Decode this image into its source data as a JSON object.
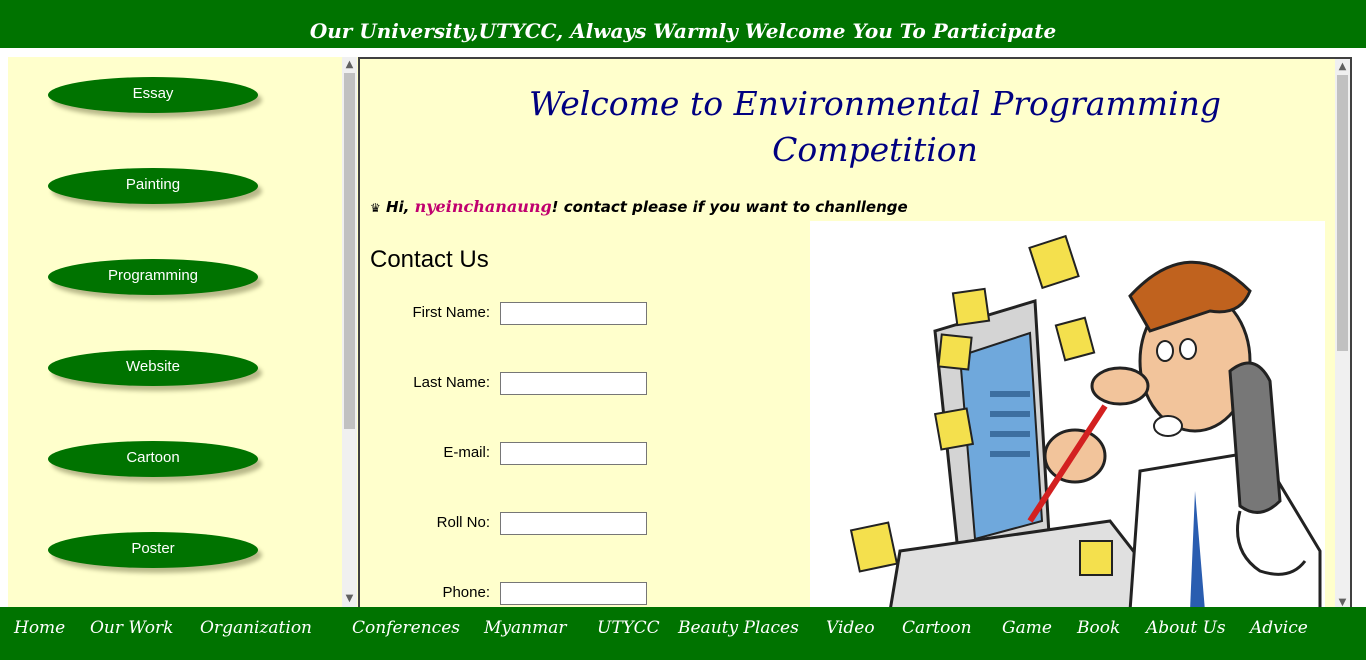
{
  "banner": {
    "text": "Our University,UTYCC, Always Warmly Welcome You To Participate"
  },
  "sidebar": {
    "items": [
      {
        "label": "Essay"
      },
      {
        "label": "Painting"
      },
      {
        "label": "Programming"
      },
      {
        "label": "Website"
      },
      {
        "label": "Cartoon"
      },
      {
        "label": "Poster"
      }
    ]
  },
  "main": {
    "title_line1": "Welcome to Environmental Programming",
    "title_line2": "Competition",
    "greeting": {
      "icon": "crown-icon",
      "prefix": "Hi, ",
      "username": "nyeinchanaung",
      "suffix": "! contact please if you want to chanllenge"
    },
    "contact_heading": "Contact Us",
    "form": {
      "first_name_label": "First Name:",
      "first_name_value": "",
      "last_name_label": "Last Name:",
      "last_name_value": "",
      "email_label": "E-mail:",
      "email_value": "",
      "roll_no_label": "Roll No:",
      "roll_no_value": "",
      "phone_label": "Phone:",
      "phone_value": ""
    }
  },
  "nav": {
    "items": [
      {
        "label": "Home"
      },
      {
        "label": "Our Work"
      },
      {
        "label": "Organization"
      },
      {
        "label": "Conferences"
      },
      {
        "label": "Myanmar"
      },
      {
        "label": "UTYCC"
      },
      {
        "label": "Beauty Places"
      },
      {
        "label": "Video"
      },
      {
        "label": "Cartoon"
      },
      {
        "label": "Game"
      },
      {
        "label": "Book"
      },
      {
        "label": "About Us"
      },
      {
        "label": "Advice"
      }
    ]
  },
  "colors": {
    "brand_green": "#007300",
    "page_background": "#ffffcc",
    "title_blue": "#000080",
    "username_magenta": "#c0006f"
  }
}
